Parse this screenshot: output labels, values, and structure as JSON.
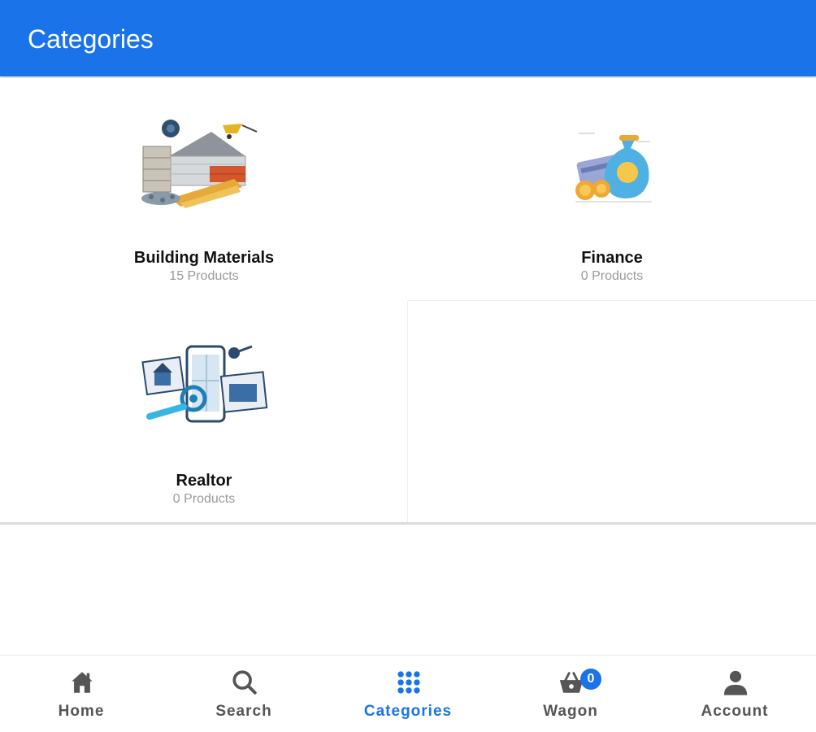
{
  "header": {
    "title": "Categories"
  },
  "categories": [
    {
      "name": "Building Materials",
      "count": "15 Products"
    },
    {
      "name": "Finance",
      "count": "0 Products"
    },
    {
      "name": "Realtor",
      "count": "0 Products"
    }
  ],
  "bottom_nav": {
    "items": [
      {
        "label": "Home",
        "icon": "home-icon"
      },
      {
        "label": "Search",
        "icon": "search-icon"
      },
      {
        "label": "Categories",
        "icon": "grid-icon",
        "active": true
      },
      {
        "label": "Wagon",
        "icon": "basket-icon",
        "badge": "0"
      },
      {
        "label": "Account",
        "icon": "person-icon"
      }
    ]
  },
  "colors": {
    "primary": "#1a73e8",
    "nav_inactive": "#555555",
    "muted_text": "#9a9a9a"
  }
}
